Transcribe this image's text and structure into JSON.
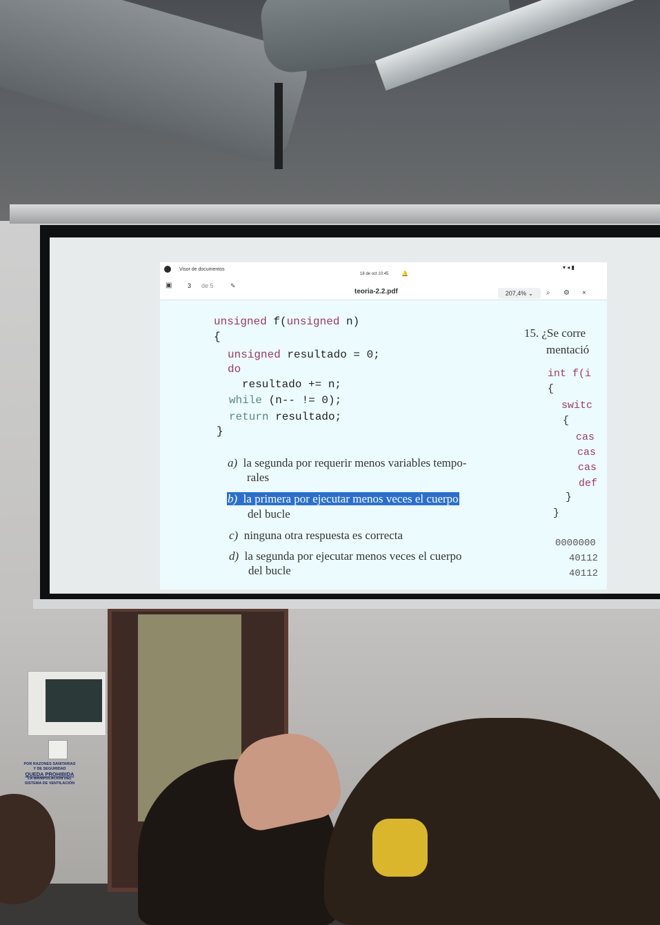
{
  "window": {
    "app_name": "Visor de documentos",
    "clock": "18 de oct  10:45",
    "page_current": "3",
    "page_of": "de 5",
    "title": "teoria-2.2.pdf",
    "zoom": "207,4%"
  },
  "code_left": {
    "line1_type": "unsigned",
    "line1_rest": " f(",
    "line1_type2": "unsigned",
    "line1_end": " n)",
    "line2": "{",
    "line3_type": "unsigned",
    "line3_rest": " resultado = 0;",
    "line4": "do",
    "line5": "resultado += n;",
    "line6_kw": "while",
    "line6_rest": " (n-- != 0);",
    "line7_kw": "return",
    "line7_rest": " resultado;",
    "line8": "}"
  },
  "options": [
    {
      "letter": "a)",
      "line1": "la segunda por requerir menos variables tempo-",
      "line2": "rales"
    },
    {
      "letter": "b)",
      "line1": "la primera por ejecutar menos veces el cuerpo",
      "line2": "del bucle"
    },
    {
      "letter": "c)",
      "line1": "ninguna otra respuesta es correcta",
      "line2": ""
    },
    {
      "letter": "d)",
      "line1": "la segunda por ejecutar menos veces el cuerpo",
      "line2": "del bucle"
    }
  ],
  "right_column": {
    "question_number": "15.",
    "question_line1": "¿Se corre",
    "question_line2": "mentació",
    "code1": "int f(i",
    "code2": "{",
    "code3": "switc",
    "code4": "{",
    "code5": "cas",
    "code6": "cas",
    "code7": "cas",
    "code8": "def",
    "code9": "}",
    "code10": "}",
    "hex1": "0000000",
    "hex2": "40112",
    "hex3": "40112"
  },
  "wall_sign": {
    "line1": "POR RAZONES SANITARIAS",
    "line2": "Y DE SEGURIDAD",
    "line3": "QUEDA PROHIBIDA",
    "line4": "LA MANIPULACIÓN DEL",
    "line5": "SISTEMA DE VENTILACIÓN"
  },
  "colors": {
    "highlight": "#2a6fd0",
    "keyword": "#9c3a66",
    "doc_background": "#ecfbfd"
  }
}
